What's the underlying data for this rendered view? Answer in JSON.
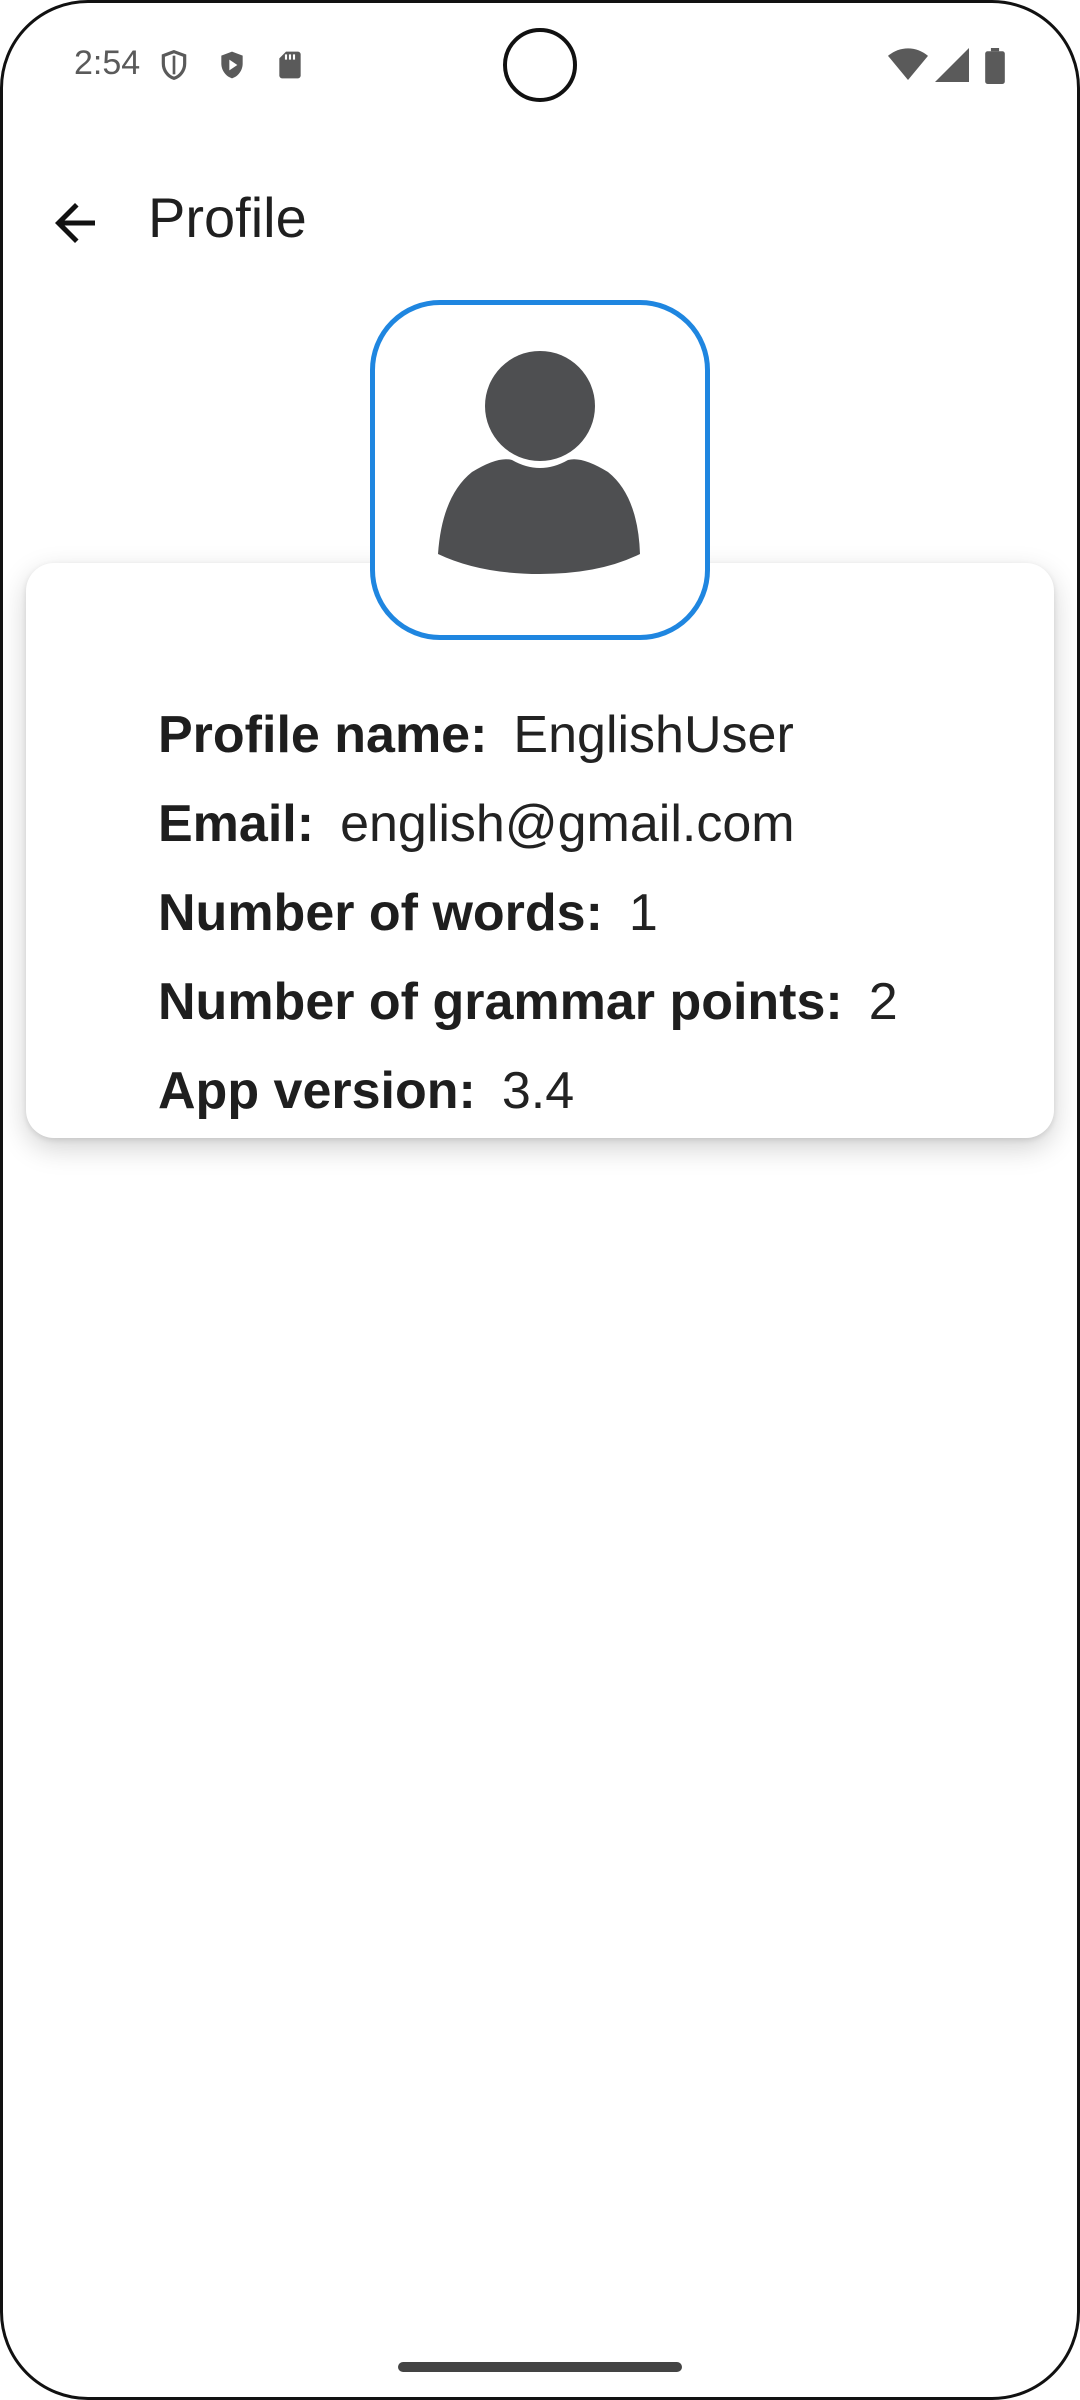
{
  "status_bar": {
    "time": "2:54",
    "icons": [
      "shield-outline-icon",
      "play-shield-icon",
      "sd-card-icon",
      "wifi-icon",
      "signal-icon",
      "battery-icon"
    ]
  },
  "toolbar": {
    "back_icon": "arrow-back-icon",
    "title": "Profile"
  },
  "avatar": {
    "icon": "person-icon",
    "border_color": "#1f86e0"
  },
  "profile": {
    "rows": [
      {
        "label": "Profile name:",
        "value": "EnglishUser"
      },
      {
        "label": "Email:",
        "value": "english@gmail.com"
      },
      {
        "label": "Number of words:",
        "value": "1"
      },
      {
        "label": "Number of grammar points:",
        "value": "2"
      },
      {
        "label": "App version:",
        "value": "3.4"
      }
    ]
  }
}
